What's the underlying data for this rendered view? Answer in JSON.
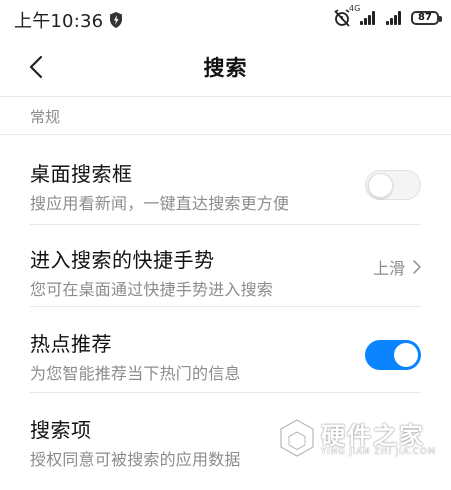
{
  "status_bar": {
    "time": "上午10:36",
    "signal1_label": "4G",
    "battery": "87"
  },
  "header": {
    "title": "搜索"
  },
  "section": {
    "label": "常规"
  },
  "rows": [
    {
      "title": "桌面搜索框",
      "subtitle": "搜应用看新闻，一键直达搜索更方便",
      "toggle_on": false
    },
    {
      "title": "进入搜索的快捷手势",
      "subtitle": "您可在桌面通过快捷手势进入搜索",
      "value": "上滑"
    },
    {
      "title": "热点推荐",
      "subtitle": "为您智能推荐当下热门的信息",
      "toggle_on": true
    },
    {
      "title": "搜索项",
      "subtitle": "授权同意可被搜索的应用数据"
    }
  ],
  "watermark": {
    "title": "硬件之家",
    "subtitle": "YING JIAN ZHI JIA.COM"
  },
  "colors": {
    "accent": "#0d84ff",
    "divider": "#e8e8e8",
    "secondary_text": "#8c8c8c"
  },
  "icons": {
    "back": "back-arrow-icon",
    "shield": "shield-icon",
    "alarm": "alarm-off-icon",
    "chevron": "chevron-right-icon"
  }
}
